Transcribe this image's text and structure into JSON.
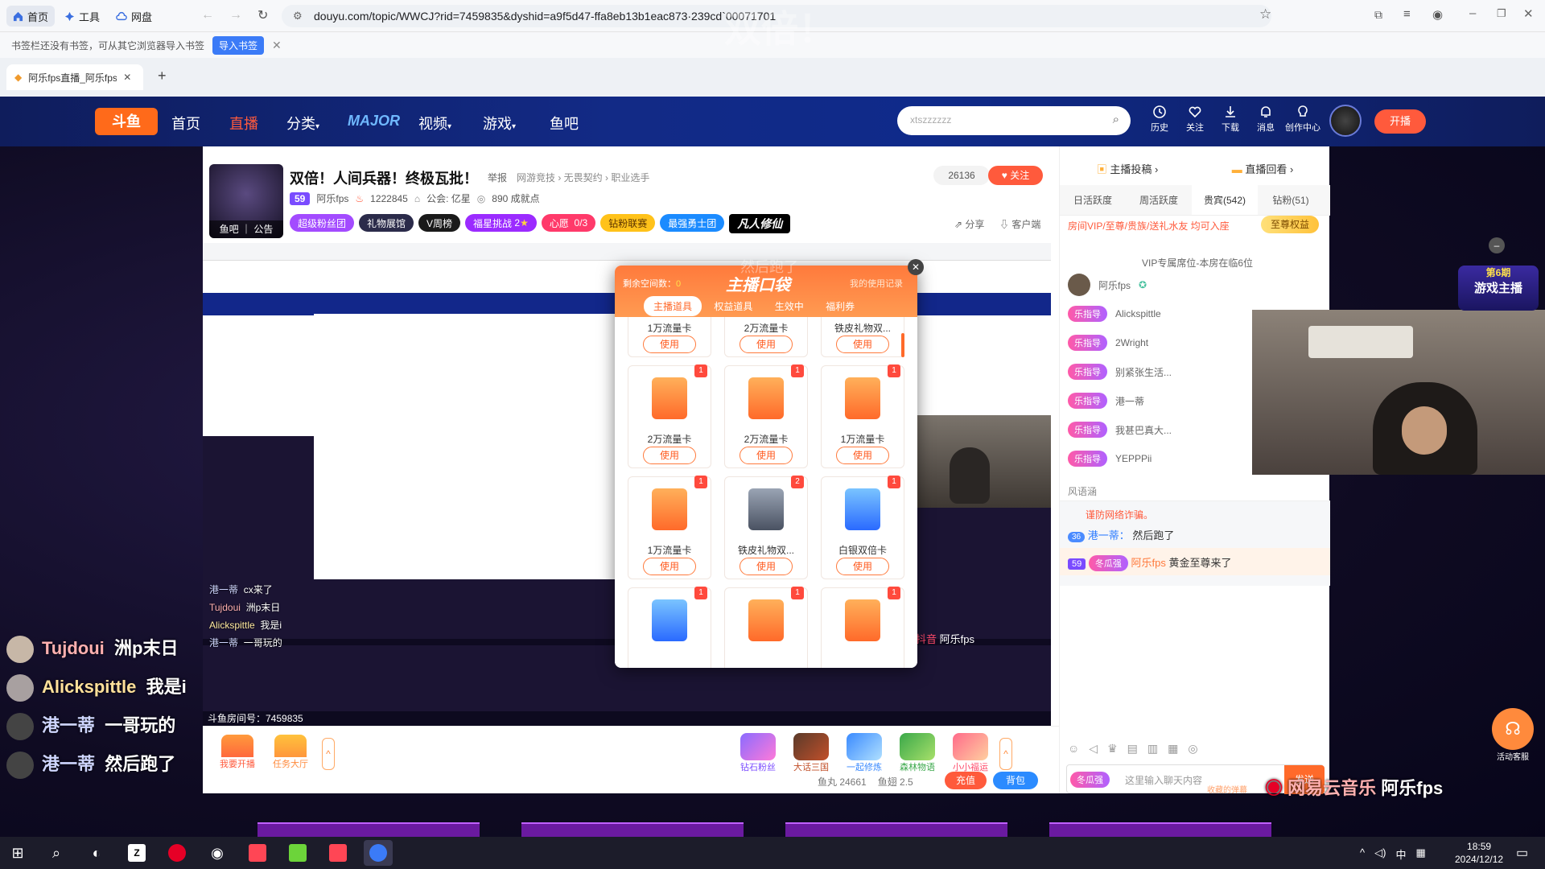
{
  "browser": {
    "home_label": "首页",
    "tools_label": "工具",
    "drive_label": "网盘",
    "url": "douyu.com/topic/WWCJ?rid=7459835&dyshid=a9f5d47-ffa8eb13b1eac873·239cd`00071701",
    "bookmark_hint": "书签栏还没有书签，可从其它浏览器导入书签",
    "import_label": "导入书签",
    "tab_title": "阿乐fps直播_阿乐fps"
  },
  "site_nav": {
    "home": "首页",
    "live": "直播",
    "category": "分类",
    "major": "MAJOR",
    "video": "视频",
    "games": "游戏",
    "fishbar": "鱼吧",
    "search_placeholder": "xtszzzzzz",
    "icons": [
      {
        "name": "history-icon",
        "label": "历史"
      },
      {
        "name": "follow-icon",
        "label": "关注"
      },
      {
        "name": "download-icon",
        "label": "下载"
      },
      {
        "name": "message-icon",
        "label": "消息"
      },
      {
        "name": "creator-icon",
        "label": "创作中心"
      }
    ],
    "start_live": "开播"
  },
  "room": {
    "title": "双倍！人间兵器！终极瓦批！",
    "report": "举报",
    "breadcrumb": "网游竞技 › 无畏契约 › 职业选手",
    "level": "59",
    "streamer": "阿乐fps",
    "heat": "1222845",
    "guild": "公会: 亿星",
    "achievements": "890 成就点",
    "followers": "26136",
    "follow_label": "关注",
    "avatar_caption": "鱼吧 ｜ 公告",
    "share": "分享",
    "client": "客户端",
    "badges": [
      "超级粉丝团",
      "礼物展馆",
      "V周榜",
      "福星挑战",
      "心愿",
      "0/3",
      "钻粉联赛",
      "最强勇士团"
    ],
    "wish_count": "2",
    "logo_text": "凡人修仙"
  },
  "bag": {
    "remaining_label": "剩余空间数：",
    "remaining_value": "0",
    "title": "主播口袋",
    "history_link": "我的使用记录",
    "tabs": [
      "主播道具",
      "权益道具",
      "生效中",
      "福利券"
    ],
    "use_label": "使用",
    "row0": [
      "1万流量卡",
      "2万流量卡",
      "铁皮礼物双..."
    ],
    "items": [
      {
        "name": "2万流量卡",
        "count": "1"
      },
      {
        "name": "2万流量卡",
        "count": "1"
      },
      {
        "name": "1万流量卡",
        "count": "1"
      },
      {
        "name": "1万流量卡",
        "count": "1"
      },
      {
        "name": "铁皮礼物双...",
        "count": "2"
      },
      {
        "name": "白银双倍卡",
        "count": "1"
      }
    ],
    "row_last_counts": [
      "1",
      "1",
      "1"
    ]
  },
  "sidebar": {
    "top_links": [
      "主播投稿",
      "直播回看"
    ],
    "tabs": [
      "日活跃度",
      "周活跃度",
      "贵宾(542)",
      "钻粉(51)"
    ],
    "vip_hint": "房间VIP/至尊/贵族/送礼水友 均可入座",
    "vip_btn": "至尊权益",
    "seat_note": "VIP专属席位-本房在临6位",
    "top_user": "阿乐fps",
    "users": [
      "Alickspittle",
      "2Wright",
      "别紧张生活...",
      "港一蒂",
      "我甚巴真大...",
      "YEPPPii"
    ],
    "fan_tag": "乐指导",
    "wind_note": "风语涵",
    "warn": "谨防网络诈骗。",
    "chat_user": "港一蒂：",
    "chat_msg": "然后跑了",
    "chat_lvl": "36",
    "welcome_lvl": "59",
    "welcome_user": "阿乐fps",
    "welcome_text": "黄金至尊来了",
    "input_placeholder": "这里输入聊天内容",
    "send": "发送",
    "fan_badge": "冬瓜强",
    "collect": "收藏的弹幕",
    "event_label": "第6期",
    "event_text": "游戏主播",
    "support": "活动客服"
  },
  "danmu": [
    {
      "user": "Tujdoui",
      "text": "洲p末日"
    },
    {
      "user": "Alickspittle",
      "text": "我是i"
    },
    {
      "user": "港一蒂",
      "text": "一哥玩的"
    },
    {
      "user": "港一蒂",
      "text": "然后跑了"
    }
  ],
  "danmu_small": [
    {
      "user": "港一蒂",
      "text": "cx来了"
    },
    {
      "user": "Tujdoui",
      "text": "洲p末日"
    },
    {
      "user": "Alickspittle",
      "text": "我是i"
    },
    {
      "user": "港一蒂",
      "text": "一哥玩的"
    }
  ],
  "bottom": {
    "start_live": "我要开播",
    "task_hall": "任务大厅",
    "gifts": [
      "钻石粉丝",
      "大话三国",
      "一起修炼",
      "森林物语",
      "小小福运"
    ],
    "fish_balls": "鱼丸 24661",
    "fish_fins": "鱼翅 2.5",
    "recharge": "充值",
    "backpack": "背包",
    "room_no": "斗鱼房间号：7459835"
  },
  "watermark": {
    "douyin": "抖音",
    "douyin_user": "阿乐fps",
    "music": "网易云音乐",
    "music_user": "阿乐fps"
  },
  "overlay_title": "双倍！",
  "overlay_mid": "然后跑了",
  "taskbar": {
    "time": "18:59",
    "date": "2024/12/12",
    "ime": "中"
  }
}
